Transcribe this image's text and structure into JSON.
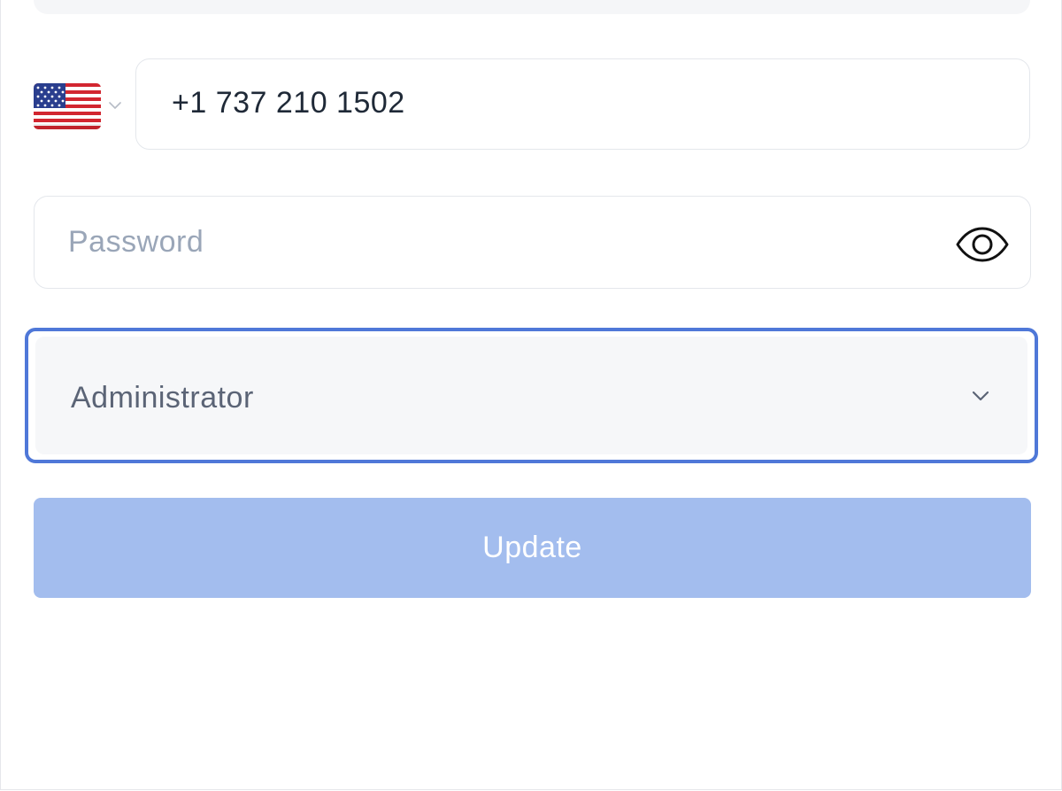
{
  "phone": {
    "country": "United States",
    "value": "+1 737 210 1502"
  },
  "password": {
    "placeholder": "Password",
    "toggle_icon": "eye-icon"
  },
  "role": {
    "selected": "Administrator",
    "expand_icon": "chevron-down-icon"
  },
  "actions": {
    "update_label": "Update"
  },
  "colors": {
    "accent_focus": "#4f78d8",
    "button_bg": "#a3bdee",
    "border": "#e4e7ec",
    "placeholder": "#9aa6b8"
  }
}
